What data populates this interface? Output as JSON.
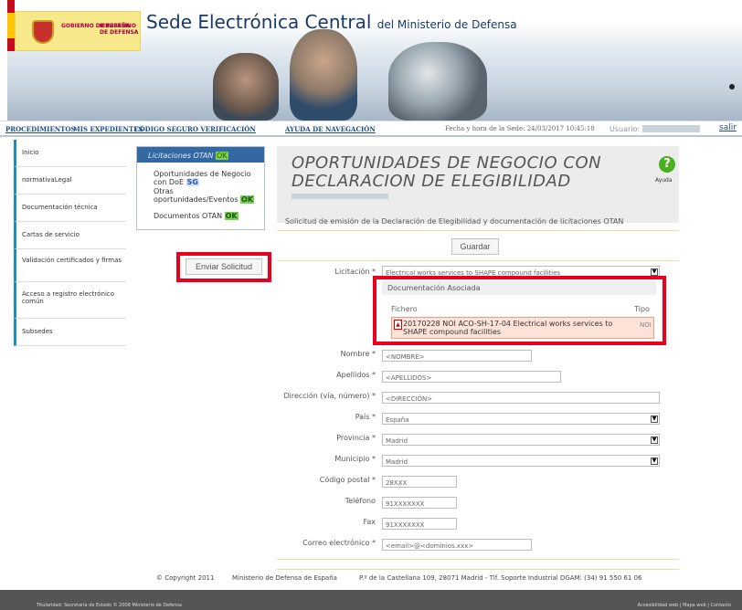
{
  "header": {
    "gov1": "GOBIERNO DE ESPAÑA",
    "gov2": "MINISTERIO DE DEFENSA",
    "site_title_main": "Sede Electrónica Central",
    "site_title_small": "del Ministerio de Defensa"
  },
  "nav": {
    "procedimientos": "PROCEDIMIENTOS",
    "expedientes": "MIS EXPEDIENTES",
    "codigo": "CÓDIGO SEGURO VERIFICACIÓN",
    "ayuda": "AYUDA DE NAVEGACIÓN",
    "date": "Fecha y hora de la Sede: 24/03/2017 10:45:18",
    "user_label": "Usuario:",
    "salir": "salir"
  },
  "sidebar": {
    "items": [
      {
        "label": "Inicio"
      },
      {
        "label": "normativaLegal"
      },
      {
        "label": "Documentación técnica"
      },
      {
        "label": "Cartas de servicio"
      },
      {
        "label": "Validación certificados y firmas"
      },
      {
        "label": "Acceso a registro electrónico común"
      },
      {
        "label": "Subsedes"
      }
    ]
  },
  "otan": {
    "title": "Licitaciones OTAN",
    "badge": "OK",
    "items": [
      {
        "label": "Oportunidades de Negocio con DoE",
        "tag": "SG"
      },
      {
        "label": "Otras oportunidades/Eventos",
        "tag": "OK"
      },
      {
        "label": "Documentos OTAN",
        "tag": "OK"
      }
    ]
  },
  "page": {
    "title": "OPORTUNIDADES DE NEGOCIO CON DECLARACION DE ELEGIBILIDAD",
    "help": "Ayuda",
    "subtitle": "Solicitud de emisión de la Declaración de Elegibilidad y documentación de licitaciones OTAN",
    "save": "Guardar",
    "send": "Enviar Solicitud"
  },
  "form": {
    "licitacion": {
      "label": "Licitación *",
      "value": "Electrical works services to SHAPE compound facilities"
    },
    "docs": {
      "title": "Documentación Asociada",
      "col1": "Fichero",
      "col2": "Tipo",
      "file": "20170228 NOI ACO-SH-17-04 Electrical works services to SHAPE compound facilities",
      "type": "NOI"
    },
    "nombre": {
      "label": "Nombre *",
      "value": "<NOMBRE>"
    },
    "apellidos": {
      "label": "Apellidos *",
      "value": "<APELLIDOS>"
    },
    "direccion": {
      "label": "Dirección (vía, número) *",
      "value": "<DIRECCIÓN>"
    },
    "pais": {
      "label": "País *",
      "value": "España"
    },
    "provincia": {
      "label": "Provincia *",
      "value": "Madrid"
    },
    "municipio": {
      "label": "Municipio *",
      "value": "Madrid"
    },
    "cp": {
      "label": "Código postal *",
      "value": "28XXX"
    },
    "telefono": {
      "label": "Teléfono",
      "value": "91XXXXXXX"
    },
    "fax": {
      "label": "Fax",
      "value": "91XXXXXXX"
    },
    "email": {
      "label": "Correo electrónico *",
      "value": "<email>@<dominios.xxx>"
    }
  },
  "footer": {
    "copyright": "© Copyright 2011",
    "ministerio": "Ministerio de Defensa de España",
    "address": "P.º de la Castellana 109, 28071 Madrid - Tlf. Soporte Industrial DGAM: (34) 91 550 61 06",
    "bottom_left": "Titularidad: Secretaría de Estado © 2008 Ministerio de Defensa",
    "bottom_right": "Accesibilidad web | Mapa web | Contacto"
  }
}
